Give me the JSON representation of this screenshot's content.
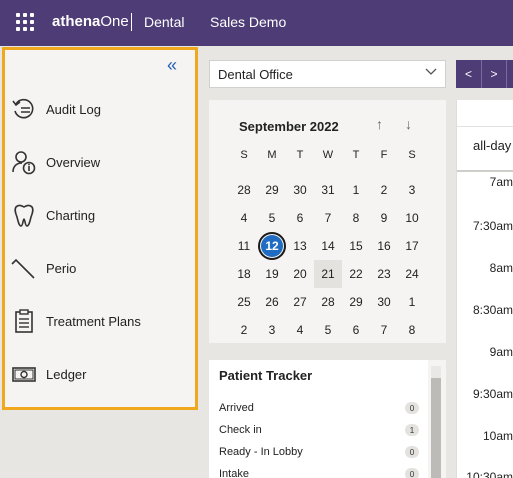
{
  "header": {
    "brand_bold": "athena",
    "brand_regular": "One",
    "app_name": "Dental",
    "practice": "Sales Demo"
  },
  "sidebar": {
    "collapse_glyph": "«",
    "items": [
      {
        "label": "Audit Log",
        "icon": "audit-log-icon"
      },
      {
        "label": "Overview",
        "icon": "overview-icon"
      },
      {
        "label": "Charting",
        "icon": "tooth-icon"
      },
      {
        "label": "Perio",
        "icon": "perio-probe-icon"
      },
      {
        "label": "Treatment Plans",
        "icon": "clipboard-icon"
      },
      {
        "label": "Ledger",
        "icon": "money-icon"
      }
    ]
  },
  "location_select": {
    "value": "Dental Office"
  },
  "nav_buttons": {
    "prev": "<",
    "next": ">"
  },
  "calendar": {
    "month_title": "September 2022",
    "up_glyph": "↑",
    "down_glyph": "↓",
    "weekdays": [
      "S",
      "M",
      "T",
      "W",
      "T",
      "F",
      "S"
    ],
    "weeks": [
      [
        "28",
        "29",
        "30",
        "31",
        "1",
        "2",
        "3"
      ],
      [
        "4",
        "5",
        "6",
        "7",
        "8",
        "9",
        "10"
      ],
      [
        "11",
        "12",
        "13",
        "14",
        "15",
        "16",
        "17"
      ],
      [
        "18",
        "19",
        "20",
        "21",
        "22",
        "23",
        "24"
      ],
      [
        "25",
        "26",
        "27",
        "28",
        "29",
        "30",
        "1"
      ],
      [
        "2",
        "3",
        "4",
        "5",
        "6",
        "7",
        "8"
      ]
    ],
    "selected": "12",
    "highlighted": "21"
  },
  "tracker": {
    "title": "Patient Tracker",
    "rows": [
      {
        "label": "Arrived",
        "count": "0"
      },
      {
        "label": "Check in",
        "count": "1"
      },
      {
        "label": "Ready - In Lobby",
        "count": "0"
      },
      {
        "label": "Intake",
        "count": "0"
      }
    ]
  },
  "schedule": {
    "allday": "all-day",
    "times": [
      "7am",
      "7:30am",
      "8am",
      "8:30am",
      "9am",
      "9:30am",
      "10am",
      "10:30am"
    ]
  }
}
